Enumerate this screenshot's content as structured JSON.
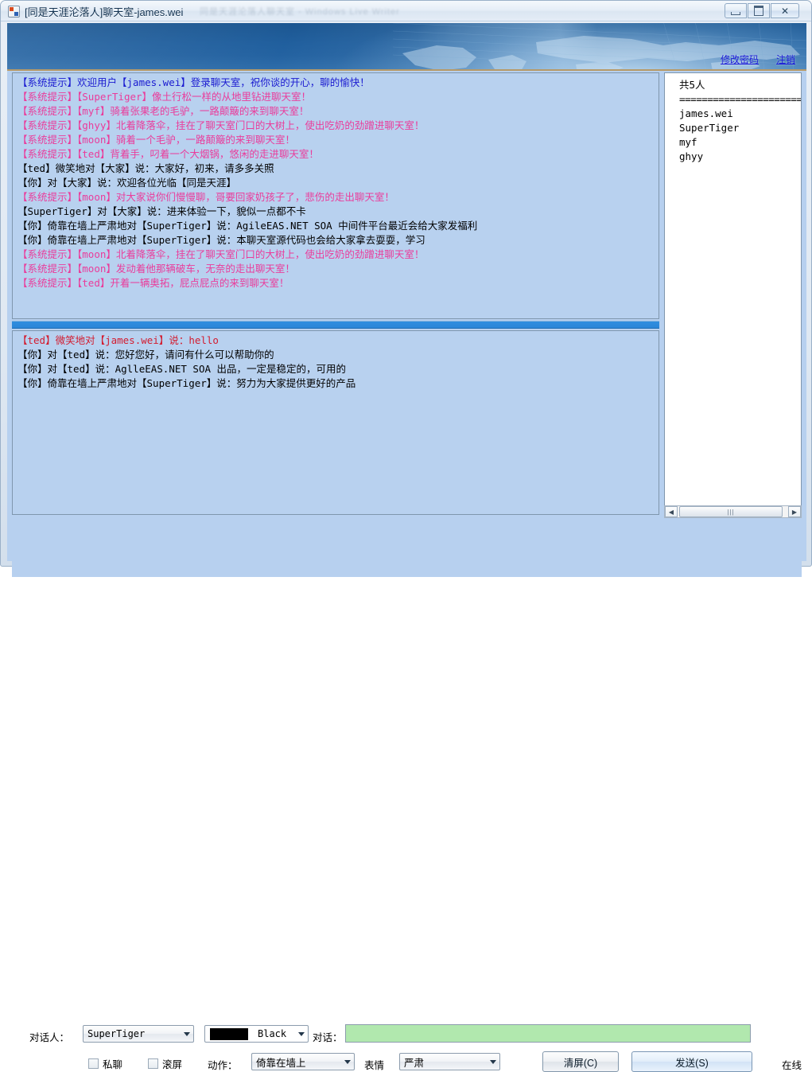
{
  "window": {
    "title": "[同是天涯沦落人]聊天室-james.wei",
    "ghost_title": "同是天涯沦落人聊天室 - Windows Live Writer",
    "minimize_label": "",
    "maximize_label": "",
    "close_label": "✕"
  },
  "banner": {
    "change_password": "修改密码",
    "logout": "注销"
  },
  "public_chat": [
    {
      "segments": [
        {
          "text": "【系统提示】欢迎用户",
          "color": "blue"
        },
        {
          "text": "【james.wei】",
          "color": "blue"
        },
        {
          "text": "登录聊天室，祝你谈的开心，聊的愉快！",
          "color": "blue"
        }
      ]
    },
    {
      "segments": [
        {
          "text": "【系统提示】",
          "color": "magenta"
        },
        {
          "text": "【SuperTiger】",
          "color": "magenta"
        },
        {
          "text": "像土行松一样的从地里钻进聊天室！",
          "color": "magenta"
        }
      ]
    },
    {
      "segments": [
        {
          "text": "【系统提示】",
          "color": "magenta"
        },
        {
          "text": "【myf】",
          "color": "magenta"
        },
        {
          "text": "骑着张果老的毛驴，一路颠簸的来到聊天室！",
          "color": "magenta"
        }
      ]
    },
    {
      "segments": [
        {
          "text": "【系统提示】",
          "color": "magenta"
        },
        {
          "text": "【ghyy】",
          "color": "magenta"
        },
        {
          "text": "北着降落伞，挂在了聊天室门口的大树上，使出吃奶的劲蹭进聊天室！",
          "color": "magenta"
        }
      ]
    },
    {
      "segments": [
        {
          "text": "【系统提示】",
          "color": "magenta"
        },
        {
          "text": "【moon】",
          "color": "magenta"
        },
        {
          "text": "骑着一个毛驴，一路颠簸的来到聊天室！",
          "color": "magenta"
        }
      ]
    },
    {
      "segments": [
        {
          "text": "【系统提示】",
          "color": "magenta"
        },
        {
          "text": "【ted】",
          "color": "magenta"
        },
        {
          "text": "背着手，叼着一个大烟锅，悠闲的走进聊天室！",
          "color": "magenta"
        }
      ]
    },
    {
      "segments": [
        {
          "text": "【ted】微笑地对",
          "color": "black"
        },
        {
          "text": "【大家】",
          "color": "black"
        },
        {
          "text": "说：大家好，初来，请多多关照",
          "color": "black"
        }
      ]
    },
    {
      "segments": [
        {
          "text": "【你】对",
          "color": "black"
        },
        {
          "text": "【大家】",
          "color": "black"
        },
        {
          "text": "说：欢迎各位光临【同是天涯】",
          "color": "black"
        }
      ]
    },
    {
      "segments": [
        {
          "text": "【系统提示】",
          "color": "magenta"
        },
        {
          "text": "【moon】",
          "color": "magenta"
        },
        {
          "text": "对大家说你们慢慢聊，哥要回家奶孩子了，悲伤的走出聊天室！",
          "color": "magenta"
        }
      ]
    },
    {
      "segments": [
        {
          "text": "【SuperTiger】对",
          "color": "black"
        },
        {
          "text": "【大家】",
          "color": "black"
        },
        {
          "text": "说：进来体验一下，貌似一点都不卡",
          "color": "black"
        }
      ]
    },
    {
      "segments": [
        {
          "text": "【你】倚靠在墙上严肃地对",
          "color": "black"
        },
        {
          "text": "【SuperTiger】",
          "color": "black"
        },
        {
          "text": "说：AgileEAS.NET SOA 中间件平台最近会给大家发福利",
          "color": "black"
        }
      ]
    },
    {
      "segments": [
        {
          "text": "【你】倚靠在墙上严肃地对",
          "color": "black"
        },
        {
          "text": "【SuperTiger】",
          "color": "black"
        },
        {
          "text": "说：本聊天室源代码也会给大家拿去耍耍，学习",
          "color": "black"
        }
      ]
    },
    {
      "segments": [
        {
          "text": "【系统提示】",
          "color": "magenta"
        },
        {
          "text": "【moon】",
          "color": "magenta"
        },
        {
          "text": "北着降落伞，挂在了聊天室门口的大树上，使出吃奶的劲蹭进聊天室！",
          "color": "magenta"
        }
      ]
    },
    {
      "segments": [
        {
          "text": "【系统提示】",
          "color": "magenta"
        },
        {
          "text": "【moon】",
          "color": "magenta"
        },
        {
          "text": "发动着他那辆破车，无奈的走出聊天室！",
          "color": "magenta"
        }
      ]
    },
    {
      "segments": [
        {
          "text": "【系统提示】",
          "color": "magenta"
        },
        {
          "text": "【ted】",
          "color": "magenta"
        },
        {
          "text": "开着一辆奥拓，屁点屁点的来到聊天室！",
          "color": "magenta"
        }
      ]
    }
  ],
  "private_chat": [
    {
      "segments": [
        {
          "text": "【ted】微笑地对",
          "color": "red"
        },
        {
          "text": "【james.wei】",
          "color": "red"
        },
        {
          "text": "说：hello",
          "color": "red"
        }
      ]
    },
    {
      "segments": [
        {
          "text": "【你】对",
          "color": "black"
        },
        {
          "text": "【ted】",
          "color": "black"
        },
        {
          "text": "说：您好您好，请问有什么可以帮助你的",
          "color": "black"
        }
      ]
    },
    {
      "segments": [
        {
          "text": "【你】对",
          "color": "black"
        },
        {
          "text": "【ted】",
          "color": "black"
        },
        {
          "text": "说：AglleEAS.NET SOA 出品，一定是稳定的，可用的",
          "color": "black"
        }
      ]
    },
    {
      "segments": [
        {
          "text": "【你】倚靠在墙上严肃地对",
          "color": "black"
        },
        {
          "text": "【SuperTiger】",
          "color": "black"
        },
        {
          "text": "说：努力为大家提供更好的产品",
          "color": "black"
        }
      ]
    }
  ],
  "userlist": {
    "count_label": "共5人",
    "separator": "======================",
    "users": [
      "james.wei",
      "SuperTiger",
      "myf",
      "ghyy"
    ]
  },
  "controls": {
    "target_label": "对话人：",
    "target_value": "SuperTiger",
    "color_value": "Black",
    "color_hex": "#000000",
    "dialog_label": "对话：",
    "dialog_value": "",
    "dialog_placeholder": "",
    "private_label": "私聊",
    "private_checked": false,
    "scroll_label": "滚屏",
    "scroll_checked": false,
    "action_label": "动作：",
    "action_value": "倚靠在墙上",
    "emotion_label": "表情",
    "emotion_value": "严肃",
    "clear_button": "清屏(C)",
    "send_button": "发送(S)",
    "status": "在线"
  },
  "scrollbar": {
    "left_arrow": "◀",
    "right_arrow": "▶",
    "thumb_grip": "|||"
  }
}
